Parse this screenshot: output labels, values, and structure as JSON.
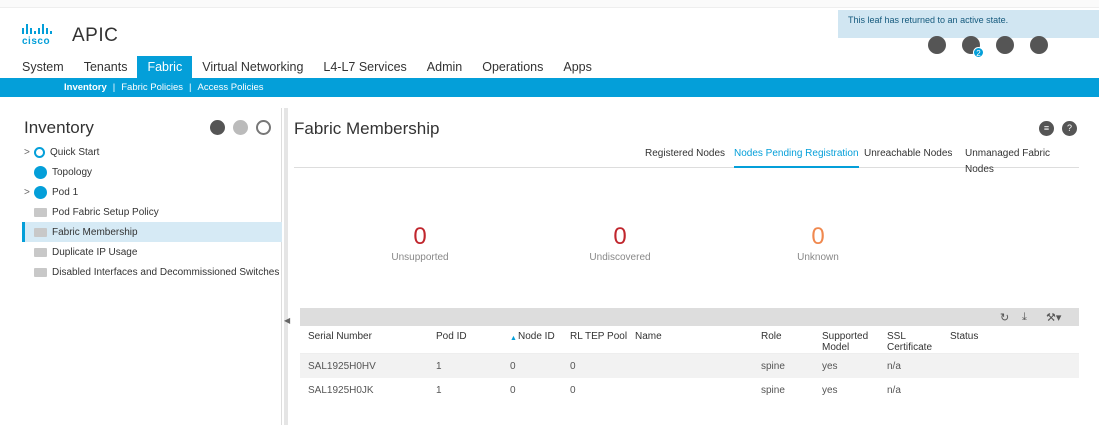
{
  "app": {
    "brand": "cisco",
    "title": "APIC",
    "notification": "This leaf has returned to an active state.",
    "badge_count": "2"
  },
  "main_nav": [
    "System",
    "Tenants",
    "Fabric",
    "Virtual Networking",
    "L4-L7 Services",
    "Admin",
    "Operations",
    "Apps"
  ],
  "sub_nav": {
    "inventory": "Inventory",
    "sep": "|",
    "fabric_policies": "Fabric Policies",
    "access_policies": "Access Policies"
  },
  "left": {
    "title": "Inventory",
    "tree": [
      {
        "label": "Quick Start",
        "caret": ">"
      },
      {
        "label": "Topology",
        "caret": ""
      },
      {
        "label": "Pod 1",
        "caret": ">"
      },
      {
        "label": "Pod Fabric Setup Policy",
        "caret": ""
      },
      {
        "label": "Fabric Membership",
        "caret": ""
      },
      {
        "label": "Duplicate IP Usage",
        "caret": ""
      },
      {
        "label": "Disabled Interfaces and Decommissioned Switches",
        "caret": ""
      }
    ]
  },
  "main": {
    "title": "Fabric Membership",
    "tabs": [
      "Registered Nodes",
      "Nodes Pending Registration",
      "Unreachable Nodes",
      "Unmanaged Fabric Nodes"
    ],
    "stats": [
      {
        "value": "0",
        "label": "Unsupported",
        "color": "#c0262d"
      },
      {
        "value": "0",
        "label": "Undiscovered",
        "color": "#c0262d"
      },
      {
        "value": "0",
        "label": "Unknown",
        "color": "#f0884e"
      }
    ],
    "table": {
      "columns": [
        "Serial Number",
        "Pod ID",
        "Node ID",
        "RL TEP Pool",
        "Name",
        "Role",
        "Supported Model",
        "SSL Certificate",
        "Status"
      ],
      "sort_indicator": "▲",
      "rows": [
        [
          "SAL1925H0HV",
          "1",
          "0",
          "0",
          "",
          "spine",
          "yes",
          "n/a",
          ""
        ],
        [
          "SAL1925H0JK",
          "1",
          "0",
          "0",
          "",
          "spine",
          "yes",
          "n/a",
          ""
        ]
      ]
    }
  },
  "colors": {
    "accent": "#049fd9",
    "error": "#c0262d",
    "warning": "#f0884e"
  }
}
